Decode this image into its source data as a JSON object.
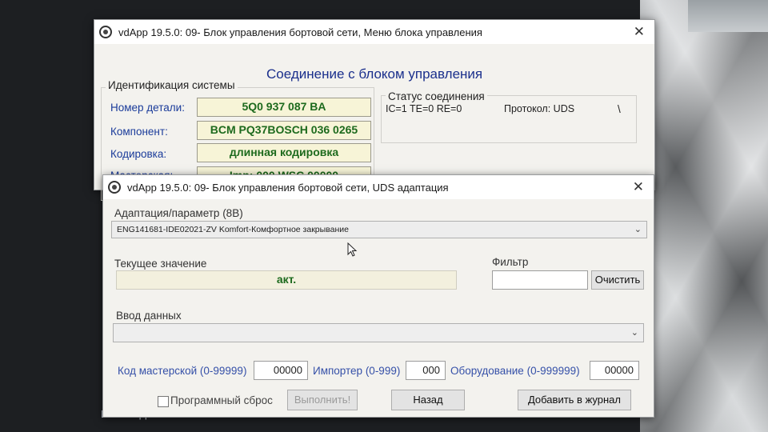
{
  "desktop": {
    "file_label": "NFS.02.ppx"
  },
  "window_back": {
    "title": "vdApp 19.5.0: 09- Блок управления бортовой сети,  Меню блока управления",
    "header": "Соединение с блоком управления",
    "system_id_group": "Идентификация системы",
    "part_number_label": "Номер детали:",
    "part_number_value": "5Q0 937 087 BA",
    "component_label": "Компонент:",
    "component_value": "BCM PQ37BOSCH 036 0265",
    "coding_label": "Кодировка:",
    "coding_value": "длинная кодировка",
    "workshop_label": "Мастерская:",
    "workshop_value": "Imp: 000     WSC 00000",
    "status_group": "Статус соединения",
    "status_counts": "IC=1  TE=0   RE=0",
    "protocol": "Протокол: UDS",
    "spinner": "\\"
  },
  "window_front": {
    "title": "vdApp 19.5.0: 09- Блок управления бортовой сети,  UDS адаптация",
    "adaptation_label": "Адаптация/параметр (8В)",
    "adaptation_value": "ENG141681-IDE02021-ZV Komfort-Комфортное закрывание",
    "current_value_label": "Текущее значение",
    "current_value": "акт.",
    "filter_label": "Фильтр",
    "filter_value": "",
    "clear_button": "Очистить",
    "data_entry_label": "Ввод данных",
    "data_entry_value": "",
    "workshop_code_label": "Код мастерской (0-99999)",
    "workshop_code_value": "00000",
    "importer_label": "Импортер (0-999)",
    "importer_value": "000",
    "equipment_label": "Оборудование (0-999999)",
    "equipment_value": "00000",
    "soft_reset_label": "Программный сброс",
    "execute_button": "Выполнить!",
    "back_button": "Назад",
    "add_log_button": "Добавить в журнал"
  }
}
